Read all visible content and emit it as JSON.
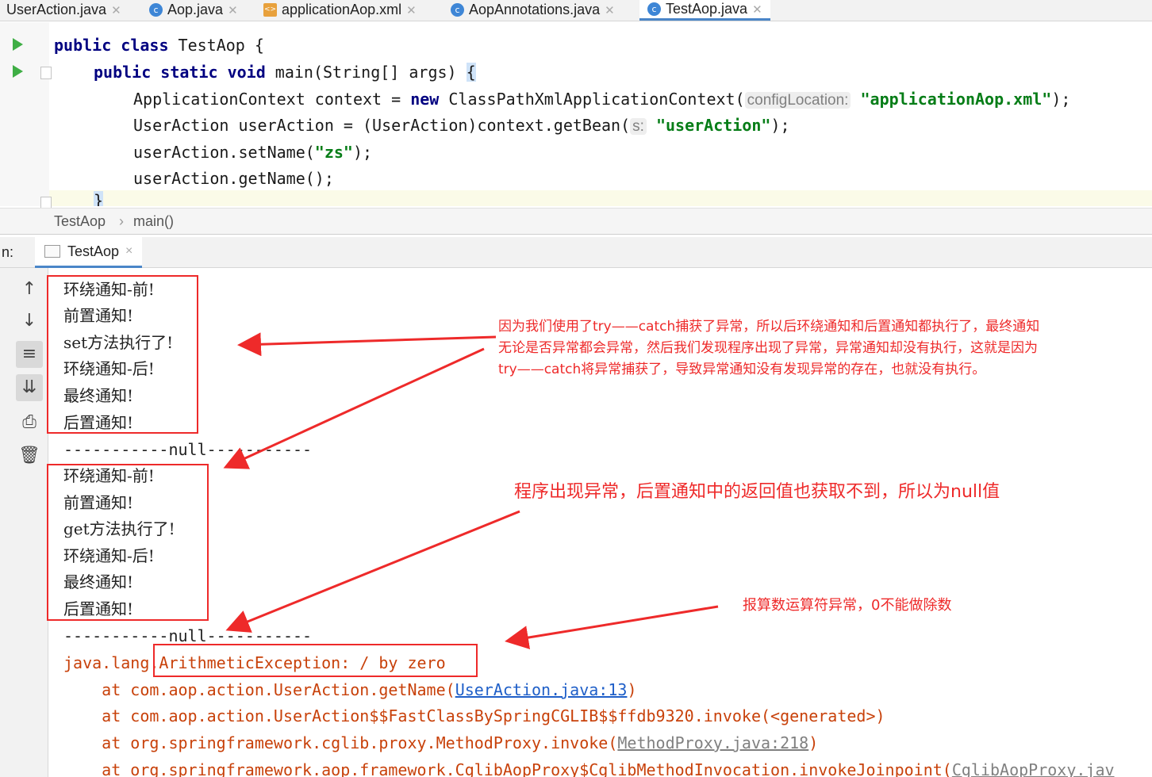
{
  "tabs": [
    {
      "label": "UserAction.java",
      "icon": "none"
    },
    {
      "label": "Aop.java",
      "icon": "class-icon"
    },
    {
      "label": "applicationAop.xml",
      "icon": "xml-icon"
    },
    {
      "label": "AopAnnotations.java",
      "icon": "class-icon"
    },
    {
      "label": "TestAop.java",
      "icon": "class-icon",
      "active": true
    }
  ],
  "code": {
    "l1_kw": "public class",
    "l1_rest": " TestAop {",
    "l2_kw": "public static void",
    "l2_rest": " main(String[] args) ",
    "l2_brace": "{",
    "l3_a": "ApplicationContext context = ",
    "l3_kw": "new",
    "l3_b": " ClassPathXmlApplicationContext(",
    "l3_hint": "configLocation:",
    "l3_str": "\"applicationAop.xml\"",
    "l3_end": ");",
    "l4_a": "UserAction userAction = (UserAction)context.getBean(",
    "l4_hint": "s:",
    "l4_str": "\"userAction\"",
    "l4_end": ");",
    "l5_a": "userAction.setName(",
    "l5_str": "\"zs\"",
    "l5_end": ");",
    "l6": "userAction.getName();",
    "l7": "}"
  },
  "breadcrumb": {
    "class": "TestAop",
    "sep": "›",
    "method": "main()"
  },
  "run": {
    "left_label": "n:",
    "tab_label": "TestAop",
    "close": "×"
  },
  "console": {
    "group1": [
      "环绕通知-前!",
      "前置通知!",
      "set方法执行了!",
      "环绕通知-后!",
      "最终通知!",
      "后置通知!"
    ],
    "null_line": "-----------null-----------",
    "group2": [
      "环绕通知-前!",
      "前置通知!",
      "get方法执行了!",
      "环绕通知-后!",
      "最终通知!",
      "后置通知!"
    ],
    "exc_prefix": "java.lang.",
    "exc_rest": "ArithmeticException: / by zero",
    "stack": [
      {
        "pre": "    at com.aop.action.UserAction.getName(",
        "link": "UserAction.java:13",
        "post": ")",
        "style": "link"
      },
      {
        "pre": "    at com.aop.action.UserAction$$FastClassBySpringCGLIB$$ffdb9320.invoke(<generated>)",
        "link": "",
        "post": "",
        "style": "link"
      },
      {
        "pre": "    at org.springframework.cglib.proxy.MethodProxy.invoke(",
        "link": "MethodProxy.java:218",
        "post": ")",
        "style": "dim"
      },
      {
        "pre": "    at org.springframework.aop.framework.CglibAopProxy$CglibMethodInvocation.invokeJoinpoint(",
        "link": "CglibAopProxy.jav",
        "post": "",
        "style": "dim"
      }
    ]
  },
  "annotations": {
    "note1": "因为我们使用了try——catch捕获了异常，所以后环绕通知和后置通知都执行了，最终通知\n无论是否异常都会异常，然后我们发现程序出现了异常，异常通知却没有执行，这就是因为\ntry——catch将异常捕获了，导致异常通知没有发现异常的存在，也就没有执行。",
    "note2": "程序出现异常，后置通知中的返回值也获取不到，所以为null值",
    "note3": "报算数运算符异常，0不能做除数"
  },
  "colors": {
    "annotation": "#ee2a2a",
    "keyword": "#000080",
    "string": "#067d17",
    "error": "#c8410a",
    "link": "#1f5fc8"
  }
}
